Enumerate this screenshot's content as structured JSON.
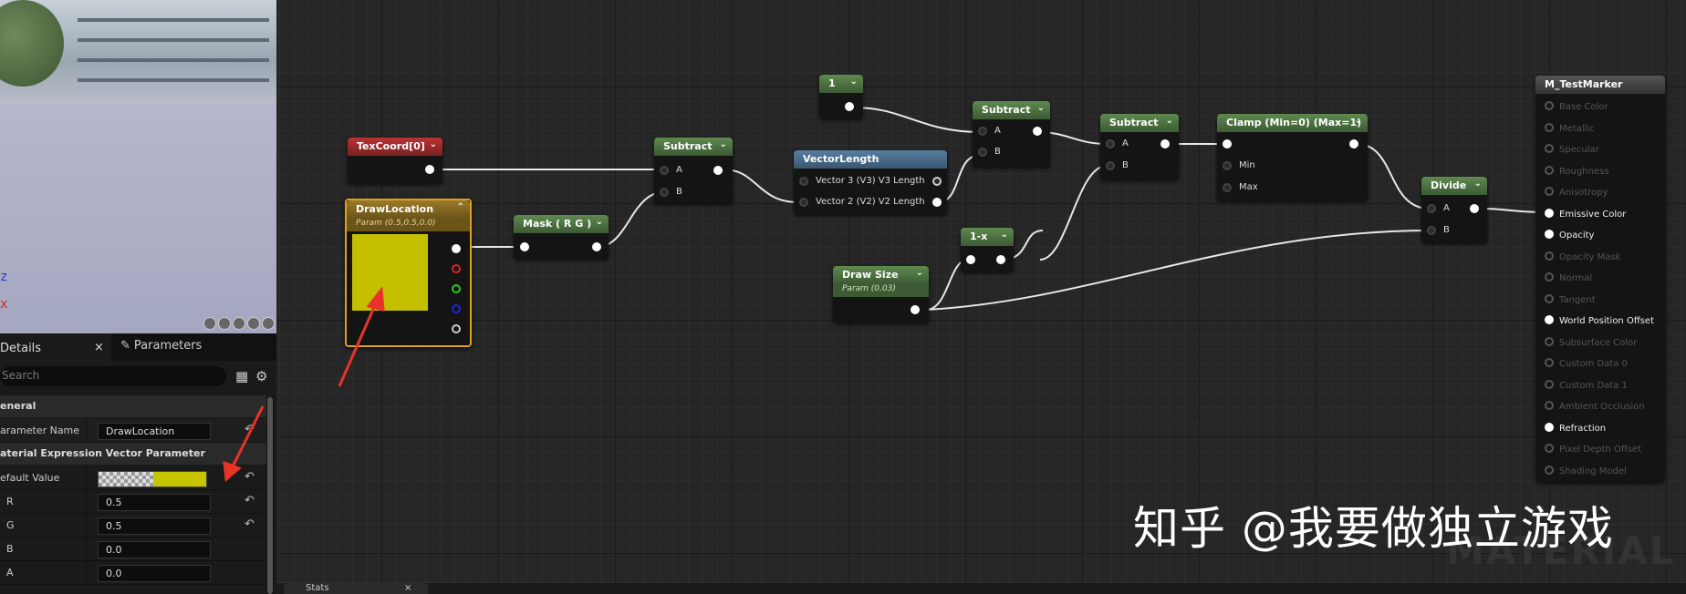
{
  "viewport": {
    "axis_z": "z",
    "axis_x": "x"
  },
  "details_panel": {
    "tab_details": "Details",
    "tab_close": "×",
    "tab_parameters": "Parameters",
    "search_placeholder": "Search",
    "section_general": "eneral",
    "param_name_label": "arameter Name",
    "param_name_value": "DrawLocation",
    "section_vector": "aterial Expression Vector Parameter",
    "default_value_label": "efault Value",
    "default_value_color": "#c7c400",
    "r_label": "R",
    "r_value": "0.5",
    "g_label": "G",
    "g_value": "0.5",
    "b_label": "B",
    "b_value": "0.0",
    "a_label": "A",
    "a_value": "0.0"
  },
  "graph": {
    "nodes": {
      "texcoord": {
        "title": "TexCoord[0]"
      },
      "drawlocation": {
        "title": "DrawLocation",
        "subtitle": "Param (0.5,0.5,0.0)",
        "preview_color": "#c4c000"
      },
      "mask": {
        "title": "Mask ( R G )"
      },
      "subtract1": {
        "title": "Subtract",
        "pin_a": "A",
        "pin_b": "B"
      },
      "vectorlength": {
        "title": "VectorLength",
        "pin1": "Vector 3 (V3) V3 Length",
        "pin2": "Vector 2 (V2) V2 Length"
      },
      "const1": {
        "title": "1"
      },
      "subtract2": {
        "title": "Subtract",
        "pin_a": "A",
        "pin_b": "B"
      },
      "oneminus": {
        "title": "1-x"
      },
      "drawsize": {
        "title": "Draw Size",
        "subtitle": "Param (0.03)"
      },
      "subtract3": {
        "title": "Subtract",
        "pin_a": "A",
        "pin_b": "B"
      },
      "clamp": {
        "title": "Clamp (Min=0) (Max=1)",
        "pin_min": "Min",
        "pin_max": "Max"
      },
      "divide": {
        "title": "Divide",
        "pin_a": "A",
        "pin_b": "B"
      },
      "material": {
        "title": "M_TestMarker",
        "pins": [
          {
            "label": "Base Color",
            "active": false
          },
          {
            "label": "Metallic",
            "active": false
          },
          {
            "label": "Specular",
            "active": false
          },
          {
            "label": "Roughness",
            "active": false
          },
          {
            "label": "Anisotropy",
            "active": false
          },
          {
            "label": "Emissive Color",
            "active": true
          },
          {
            "label": "Opacity",
            "active": true
          },
          {
            "label": "Opacity Mask",
            "active": false
          },
          {
            "label": "Normal",
            "active": false
          },
          {
            "label": "Tangent",
            "active": false
          },
          {
            "label": "World Position Offset",
            "active": true
          },
          {
            "label": "Subsurface Color",
            "active": false
          },
          {
            "label": "Custom Data 0",
            "active": false
          },
          {
            "label": "Custom Data 1",
            "active": false
          },
          {
            "label": "Ambient Occlusion",
            "active": false
          },
          {
            "label": "Refraction",
            "active": true
          },
          {
            "label": "Pixel Depth Offset",
            "active": false
          },
          {
            "label": "Shading Model",
            "active": false
          }
        ]
      }
    },
    "background_label": "MATERIAL"
  },
  "bottom": {
    "stats_tab": "Stats",
    "stats_close": "×"
  },
  "watermark": "知乎 @我要做独立游戏"
}
